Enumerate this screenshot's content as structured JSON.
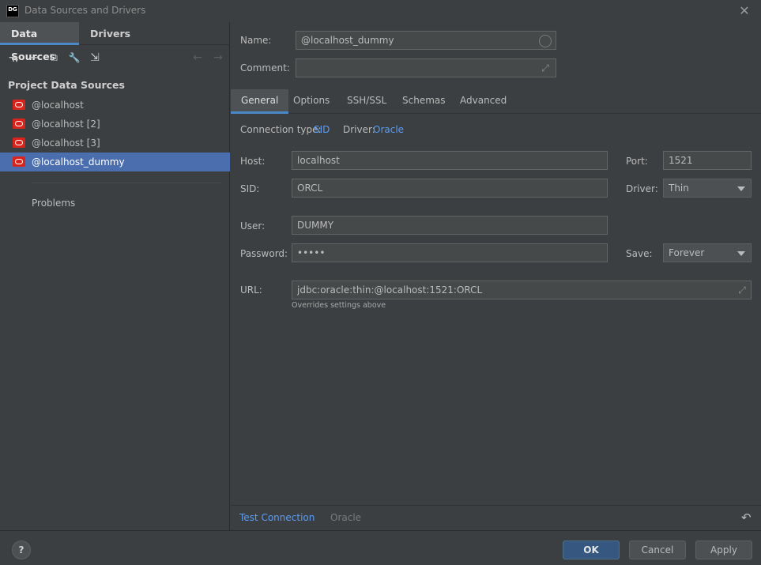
{
  "window": {
    "logo_text": "DG",
    "title": "Data Sources and Drivers",
    "close_glyph": "✕"
  },
  "left_panel": {
    "tabs": [
      {
        "label": "Data Sources",
        "active": true
      },
      {
        "label": "Drivers",
        "active": false
      }
    ],
    "toolbar": {
      "add": "+",
      "add_arrow": "▾",
      "remove": "−",
      "copy": "⧉",
      "properties": "🔧",
      "import": "⇲",
      "back": "←",
      "forward": "→"
    },
    "section_title": "Project Data Sources",
    "items": [
      {
        "label": "@localhost",
        "selected": false
      },
      {
        "label": "@localhost [2]",
        "selected": false
      },
      {
        "label": "@localhost [3]",
        "selected": false
      },
      {
        "label": "@localhost_dummy",
        "selected": true
      }
    ],
    "problems_label": "Problems"
  },
  "form": {
    "name_label": "Name:",
    "name_value": "@localhost_dummy",
    "comment_label": "Comment:",
    "comment_value": "",
    "tabs": [
      {
        "label": "General",
        "active": true
      },
      {
        "label": "Options",
        "active": false
      },
      {
        "label": "SSH/SSL",
        "active": false
      },
      {
        "label": "Schemas",
        "active": false
      },
      {
        "label": "Advanced",
        "active": false
      }
    ],
    "connection_type_label": "Connection type:",
    "connection_type_value": "SID",
    "driver_label": "Driver:",
    "driver_value": "Oracle",
    "host_label": "Host:",
    "host_value": "localhost",
    "port_label": "Port:",
    "port_value": "1521",
    "sid_label": "SID:",
    "sid_value": "ORCL",
    "driver_select_label": "Driver:",
    "driver_select_value": "Thin",
    "user_label": "User:",
    "user_value": "DUMMY",
    "password_label": "Password:",
    "password_value": "•••••",
    "save_label": "Save:",
    "save_value": "Forever",
    "url_label": "URL:",
    "url_value": "jdbc:oracle:thin:@localhost:1521:ORCL",
    "url_hint": "Overrides settings above",
    "expand_glyph": "⤢"
  },
  "bottom_bar": {
    "test_connection": "Test Connection",
    "driver_name": "Oracle",
    "undo_glyph": "↶"
  },
  "footer": {
    "help": "?",
    "ok": "OK",
    "cancel": "Cancel",
    "apply": "Apply"
  }
}
